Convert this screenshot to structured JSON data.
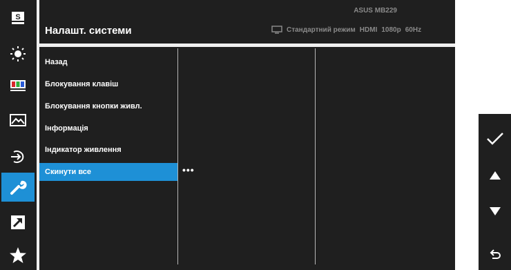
{
  "header": {
    "title": "Налашт. системи",
    "model": "ASUS MB229",
    "status": {
      "mode": "Стандартний режим",
      "input": "HDMI",
      "resolution": "1080p",
      "refresh": "60Hz"
    }
  },
  "sidebar": {
    "items": [
      {
        "icon": "splendid-icon",
        "label": "S"
      },
      {
        "icon": "brightness-icon"
      },
      {
        "icon": "color-icon"
      },
      {
        "icon": "image-icon"
      },
      {
        "icon": "input-select-icon"
      },
      {
        "icon": "system-setup-icon",
        "active": true
      },
      {
        "icon": "shortcut-icon"
      },
      {
        "icon": "favorite-icon"
      }
    ]
  },
  "menu": {
    "items": [
      {
        "label": "Назад"
      },
      {
        "label": "Блокування клавіш"
      },
      {
        "label": "Блокування кнопки живл."
      },
      {
        "label": "Інформація"
      },
      {
        "label": "Індикатор живлення"
      },
      {
        "label": "Скинути все",
        "selected": true
      }
    ],
    "submenu_indicator": "•••"
  },
  "keypad": {
    "buttons": [
      {
        "icon": "check-icon"
      },
      {
        "icon": "arrow-up-icon"
      },
      {
        "icon": "arrow-down-icon"
      },
      {
        "icon": "back-icon"
      }
    ]
  },
  "colors": {
    "accent": "#1e90d6",
    "background": "#1f1f1f",
    "text": "#ffffff",
    "muted": "#8a8a8a"
  }
}
